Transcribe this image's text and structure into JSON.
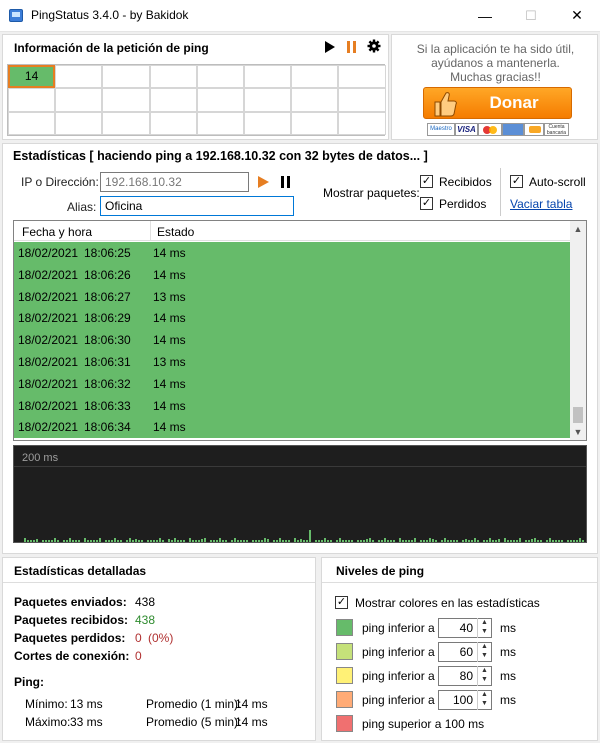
{
  "window": {
    "title": "PingStatus 3.4.0 - by Bakidok",
    "minimize": "—",
    "maximize": "☐",
    "close": "✕"
  },
  "ping_info": {
    "title": "Información de la petición de ping",
    "cells": [
      "14"
    ]
  },
  "donate": {
    "message_line1": "Si la aplicación te ha sido útil,",
    "message_line2": "ayúdanos a mantenerla.",
    "message_line3": "Muchas gracias!!",
    "button_label": "Donar",
    "cards": [
      "Maestro",
      "VISA",
      "",
      "",
      "",
      "Cuenta bancaria"
    ]
  },
  "stats_header": "Estadísticas  [ haciendo ping a 192.168.10.32 con 32 bytes de datos... ]",
  "form": {
    "ip_label": "IP o Dirección:",
    "ip_value": "192.168.10.32",
    "alias_label": "Alias:",
    "alias_value": "Oficina",
    "show_packets_label": "Mostrar paquetes:",
    "received_label": "Recibidos",
    "lost_label": "Perdidos",
    "autoscroll_label": "Auto-scroll",
    "clear_table_label": "Vaciar tabla"
  },
  "table": {
    "col_datetime": "Fecha y hora",
    "col_status": "Estado",
    "rows": [
      {
        "date": "18/02/2021",
        "time": "18:06:25",
        "status": "14 ms"
      },
      {
        "date": "18/02/2021",
        "time": "18:06:26",
        "status": "14 ms"
      },
      {
        "date": "18/02/2021",
        "time": "18:06:27",
        "status": "13 ms"
      },
      {
        "date": "18/02/2021",
        "time": "18:06:29",
        "status": "14 ms"
      },
      {
        "date": "18/02/2021",
        "time": "18:06:30",
        "status": "14 ms"
      },
      {
        "date": "18/02/2021",
        "time": "18:06:31",
        "status": "13 ms"
      },
      {
        "date": "18/02/2021",
        "time": "18:06:32",
        "status": "14 ms"
      },
      {
        "date": "18/02/2021",
        "time": "18:06:33",
        "status": "14 ms"
      },
      {
        "date": "18/02/2021",
        "time": "18:06:34",
        "status": "14 ms"
      }
    ]
  },
  "graph": {
    "scale_label": "200 ms"
  },
  "detailed": {
    "title": "Estadísticas detalladas",
    "sent_label": "Paquetes enviados:",
    "sent_value": "438",
    "received_label": "Paquetes recibidos:",
    "received_value": "438",
    "lost_label": "Paquetes perdidos:",
    "lost_value": "0",
    "lost_pct": "(0%)",
    "cuts_label": "Cortes de conexión:",
    "cuts_value": "0",
    "ping_label": "Ping:",
    "min_label": "Mínimo:",
    "min_value": "13 ms",
    "max_label": "Máximo:",
    "max_value": "33 ms",
    "avg1_label": "Promedio (1 min):",
    "avg1_value": "14 ms",
    "avg5_label": "Promedio (5 min):",
    "avg5_value": "14 ms"
  },
  "levels": {
    "title": "Niveles de ping",
    "show_colors_label": "Mostrar colores en las estadísticas",
    "items": [
      {
        "label": "ping inferior a",
        "value": "40",
        "unit": "ms",
        "color": "#66bb6a"
      },
      {
        "label": "ping inferior a",
        "value": "60",
        "unit": "ms",
        "color": "#c5e17a"
      },
      {
        "label": "ping inferior a",
        "value": "80",
        "unit": "ms",
        "color": "#fff176"
      },
      {
        "label": "ping inferior a",
        "value": "100",
        "unit": "ms",
        "color": "#ffab76"
      },
      {
        "label": "ping superior a 100 ms",
        "value": "",
        "unit": "",
        "color": "#f07070"
      }
    ]
  },
  "colors": {
    "accent_orange": "#e67e22",
    "row_green": "#66bb6a",
    "graph_bg": "#1e1e1e",
    "received_green": "#2e8b2e",
    "lost_red": "#b03030"
  }
}
